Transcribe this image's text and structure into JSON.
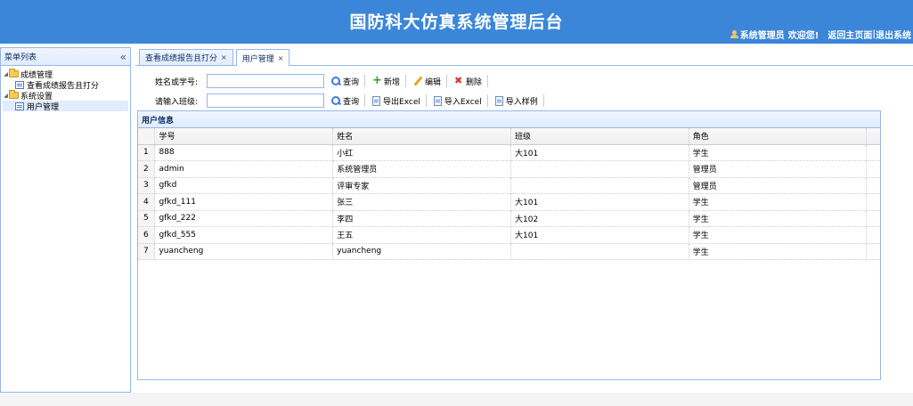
{
  "header": {
    "title": "国防科大仿真系统管理后台",
    "user_name": "系统管理员",
    "welcome": "欢迎您!",
    "home_link": "返回主页面",
    "divider": "|",
    "logout_link": "退出系统"
  },
  "sidebar": {
    "title": "菜单列表",
    "collapse_glyph": "«",
    "tree": [
      {
        "label": "成绩管理",
        "children": [
          {
            "label": "查看成绩报告且打分"
          }
        ]
      },
      {
        "label": "系统设置",
        "children": [
          {
            "label": "用户管理"
          }
        ]
      }
    ]
  },
  "tabs": [
    {
      "label": "查看成绩报告且打分",
      "close": "×"
    },
    {
      "label": "用户管理",
      "close": "×"
    }
  ],
  "toolbar": {
    "row1": {
      "label": "姓名或学号:",
      "input_value": "",
      "buttons": [
        "查询",
        "新增",
        "编辑",
        "删除"
      ]
    },
    "row2": {
      "label": "请输入班级:",
      "input_value": "",
      "buttons": [
        "查询",
        "导出Excel",
        "导入Excel",
        "导入样例"
      ]
    }
  },
  "grid": {
    "title": "用户信息",
    "columns": [
      "学号",
      "姓名",
      "班级",
      "角色"
    ],
    "rows": [
      {
        "num": "1",
        "cells": [
          "888",
          "小红",
          "大101",
          "学生"
        ]
      },
      {
        "num": "2",
        "cells": [
          "admin",
          "系统管理员",
          "",
          "管理员"
        ]
      },
      {
        "num": "3",
        "cells": [
          "gfkd",
          "评审专家",
          "",
          "管理员"
        ]
      },
      {
        "num": "4",
        "cells": [
          "gfkd_111",
          "张三",
          "大101",
          "学生"
        ]
      },
      {
        "num": "5",
        "cells": [
          "gfkd_222",
          "李四",
          "大102",
          "学生"
        ]
      },
      {
        "num": "6",
        "cells": [
          "gfkd_555",
          "王五",
          "大101",
          "学生"
        ]
      },
      {
        "num": "7",
        "cells": [
          "yuancheng",
          "yuancheng",
          "",
          "学生"
        ]
      }
    ]
  },
  "colors": {
    "header_bg": "#3b86d9",
    "panel_border": "#95b8e7"
  }
}
